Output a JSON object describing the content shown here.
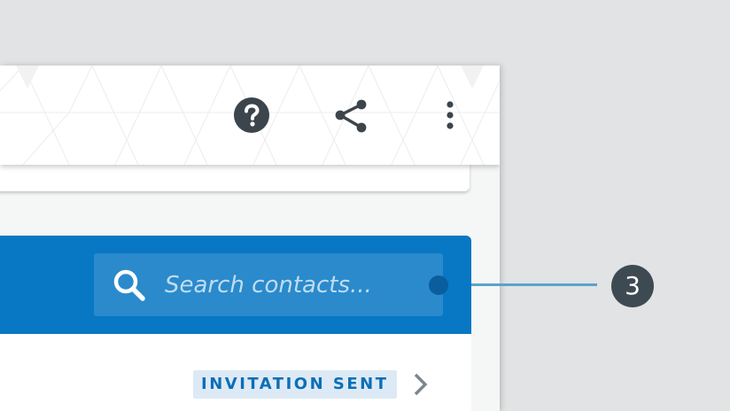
{
  "toolbar": {
    "icons": [
      "help-icon",
      "share-icon",
      "more-vert-icon"
    ]
  },
  "contacts": {
    "search": {
      "placeholder": "Search contacts...",
      "value": ""
    },
    "rows": [
      {
        "status": "INVITATION SENT"
      }
    ]
  },
  "annotation": {
    "number": "3"
  },
  "colors": {
    "background": "#e1e3e4",
    "header_blue": "#0877c4",
    "badge_bg": "#ddeaf5",
    "badge_text": "#0b6fb7",
    "callout_line": "#5aa3cc",
    "callout_badge": "#3e4a52",
    "icon_dark": "#3c454b"
  }
}
